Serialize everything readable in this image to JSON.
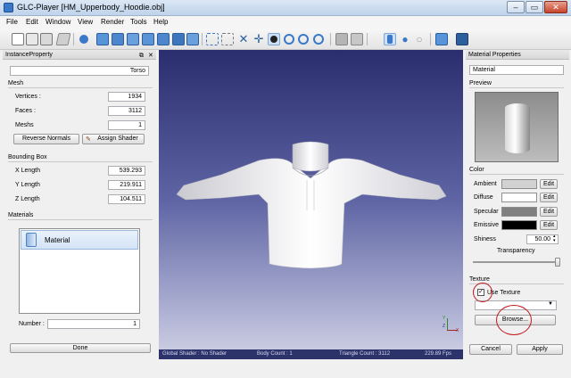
{
  "window": {
    "title": "GLC-Player [HM_Upperbody_Hoodie.obj]",
    "minimize": "–",
    "maximize": "▭",
    "close": "✕"
  },
  "menu": [
    "File",
    "Edit",
    "Window",
    "View",
    "Render",
    "Tools",
    "Help"
  ],
  "left_panel": {
    "title": "InstanceProperty",
    "name_value": "Torso",
    "mesh_group": "Mesh",
    "vertices_label": "Vertices :",
    "vertices_value": "1934",
    "faces_label": "Faces :",
    "faces_value": "3112",
    "meshs_label": "Meshs",
    "meshs_value": "1",
    "reverse_normals": "Reverse Normals",
    "assign_shader": "Assign Shader",
    "bbox_group": "Bounding Box",
    "x_length_label": "X Length",
    "x_length_value": "539.293",
    "y_length_label": "Y Length",
    "y_length_value": "219.911",
    "z_length_label": "Z Length",
    "z_length_value": "104.511",
    "materials_group": "Materials",
    "material_item": "Material",
    "number_label": "Number :",
    "number_value": "1",
    "done": "Done"
  },
  "viewport": {
    "status_shader": "Global Shader : No Shader",
    "status_body": "Body Count : 1",
    "status_triangles": "Triangle Count : 3112",
    "status_fps": "229.89 Fps",
    "axis_y": "Y",
    "axis_z": "Z",
    "axis_x": "X"
  },
  "right_panel": {
    "title": "Material Properties",
    "material_name": "Material",
    "preview_group": "Preview",
    "color_group": "Color",
    "ambient_label": "Ambient",
    "diffuse_label": "Diffuse",
    "specular_label": "Specular",
    "emissive_label": "Emissive",
    "edit": "Edit",
    "ambient_color": "#d2d2d2",
    "diffuse_color": "#ffffff",
    "specular_color": "#808080",
    "emissive_color": "#000000",
    "shiness_label": "Shiness",
    "shiness_value": "50.00",
    "transparency_label": "Transparency",
    "transparency_level": 1.0,
    "texture_group": "Texture",
    "use_texture_label": "Use Texture",
    "use_texture_checked": true,
    "texture_select_value": "",
    "browse": "Browse...",
    "cancel": "Cancel",
    "apply": "Apply"
  },
  "colors": {
    "annotation_red": "#c0171a"
  }
}
